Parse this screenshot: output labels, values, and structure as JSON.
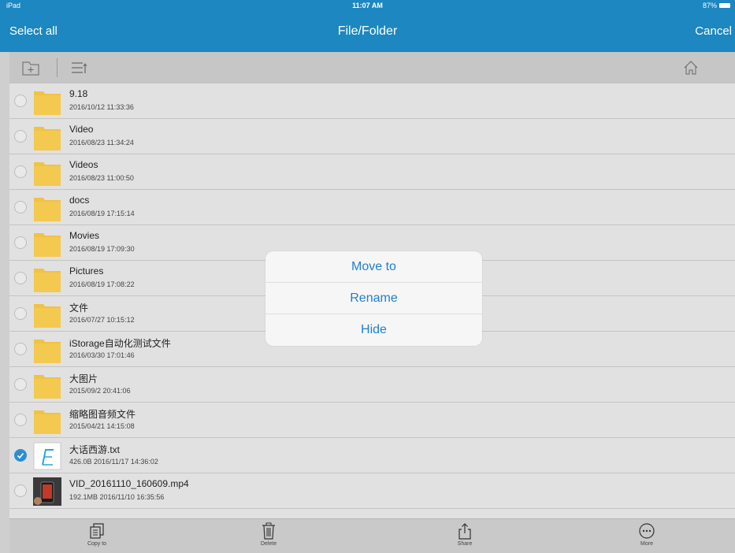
{
  "status_bar": {
    "carrier": "iPad",
    "time": "11:07 AM",
    "battery": "87%"
  },
  "nav": {
    "left": "Select all",
    "title": "File/Folder",
    "right": "Cancel"
  },
  "toolbar": {
    "icons": [
      "new-folder-icon",
      "sort-icon",
      "home-icon"
    ]
  },
  "files": [
    {
      "name": "9.18",
      "meta": "2016/10/12 11:33:36",
      "type": "folder",
      "selected": false
    },
    {
      "name": "Video",
      "meta": "2016/08/23 11:34:24",
      "type": "folder",
      "selected": false
    },
    {
      "name": "Videos",
      "meta": "2016/08/23 11:00:50",
      "type": "folder",
      "selected": false
    },
    {
      "name": "docs",
      "meta": "2016/08/19 17:15:14",
      "type": "folder",
      "selected": false
    },
    {
      "name": "Movies",
      "meta": "2016/08/19 17:09:30",
      "type": "folder",
      "selected": false
    },
    {
      "name": "Pictures",
      "meta": "2016/08/19 17:08:22",
      "type": "folder",
      "selected": false
    },
    {
      "name": "文件",
      "meta": "2016/07/27 10:15:12",
      "type": "folder",
      "selected": false
    },
    {
      "name": "iStorage自动化测试文件",
      "meta": "2016/03/30 17:01:46",
      "type": "folder",
      "selected": false
    },
    {
      "name": "大图片",
      "meta": "2015/09/2 20:41:06",
      "type": "folder",
      "selected": false
    },
    {
      "name": "缩略图音频文件",
      "meta": "2015/04/21 14:15:08",
      "type": "folder",
      "selected": false
    },
    {
      "name": "大话西游.txt",
      "meta": "426.0B 2016/11/17 14:36:02",
      "type": "txt",
      "selected": true
    },
    {
      "name": "VID_20161110_160609.mp4",
      "meta": "192.1MB 2016/11/10 16:35:56",
      "type": "video",
      "selected": false
    }
  ],
  "bottom": {
    "copy": "Copy to",
    "delete": "Delete",
    "share": "Share",
    "more": "More"
  },
  "popup": {
    "move": "Move to",
    "rename": "Rename",
    "hide": "Hide"
  },
  "colors": {
    "accent": "#1c87c0",
    "popup_text": "#1f7fd0",
    "folder": "#f0c245",
    "checked": "#2a8fd0"
  }
}
